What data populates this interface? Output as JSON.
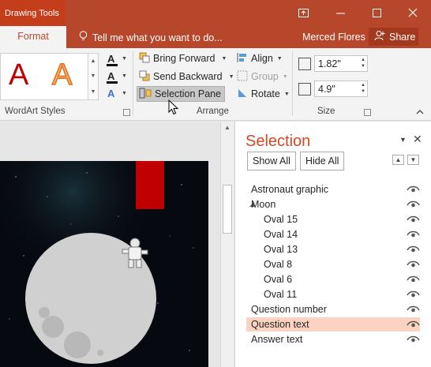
{
  "titlebar": {
    "context": "Drawing Tools",
    "controls": [
      "restore-ribbon-icon",
      "minimize-icon",
      "maximize-icon",
      "close-icon"
    ]
  },
  "tabs": {
    "format": "Format",
    "tell_me": "Tell me what you want to do...",
    "user": "Merced Flores",
    "share": "Share"
  },
  "ribbon": {
    "wordart_label": "WordArt Styles",
    "wordart_sample": "A",
    "text_format_letters": [
      "A",
      "A",
      "A"
    ],
    "arrange": {
      "bring_forward": "Bring Forward",
      "send_backward": "Send Backward",
      "selection_pane": "Selection Pane",
      "align": "Align",
      "group": "Group",
      "rotate": "Rotate",
      "label": "Arrange"
    },
    "size": {
      "height": "1.82\"",
      "width": "4.9\"",
      "label": "Size"
    }
  },
  "colors": {
    "accent": "#b7472a",
    "pane_title": "#d24726",
    "selected_row": "#fcd3c3"
  },
  "selection_pane": {
    "title": "Selection",
    "show_all": "Show All",
    "hide_all": "Hide All",
    "items": [
      {
        "label": "Astronaut graphic",
        "indent": 0,
        "group": false,
        "selected": false
      },
      {
        "label": "Moon",
        "indent": 0,
        "group": true,
        "selected": false
      },
      {
        "label": "Oval 15",
        "indent": 1,
        "group": false,
        "selected": false
      },
      {
        "label": "Oval 14",
        "indent": 1,
        "group": false,
        "selected": false
      },
      {
        "label": "Oval 13",
        "indent": 1,
        "group": false,
        "selected": false
      },
      {
        "label": "Oval 8",
        "indent": 1,
        "group": false,
        "selected": false
      },
      {
        "label": "Oval 6",
        "indent": 1,
        "group": false,
        "selected": false
      },
      {
        "label": "Oval 11",
        "indent": 1,
        "group": false,
        "selected": false
      },
      {
        "label": "Question number",
        "indent": 0,
        "group": false,
        "selected": false
      },
      {
        "label": "Question text",
        "indent": 0,
        "group": false,
        "selected": true
      },
      {
        "label": "Answer text",
        "indent": 0,
        "group": false,
        "selected": false
      }
    ]
  }
}
